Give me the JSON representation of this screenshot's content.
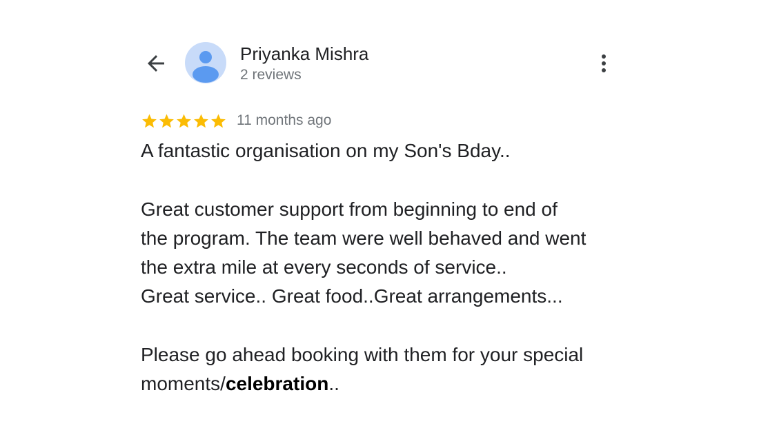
{
  "header": {
    "back_icon": "arrow-back-icon",
    "avatar_icon": "person-icon",
    "avatar_color": "#c8dbf9",
    "avatar_figure_color": "#5b9af0",
    "user_name": "Priyanka Mishra",
    "review_count": "2 reviews",
    "more_icon": "more-vertical-icon"
  },
  "review": {
    "rating": 5,
    "rating_max": 5,
    "star_color": "#fbbc04",
    "time_ago": "11 months ago",
    "line1": "A fantastic organisation on my Son's Bday..",
    "line2": "Great customer support from beginning to end of",
    "line3": "the program. The team were well behaved and went",
    "line4": "the extra mile at every seconds of service..",
    "line5": "Great service.. Great food..Great arrangements...",
    "line6": "Please go ahead booking with them for your special",
    "line7_prefix": "moments/",
    "line7_bold": "celebration",
    "line7_suffix": ".."
  }
}
